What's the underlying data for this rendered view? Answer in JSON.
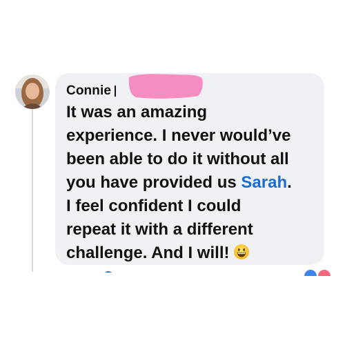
{
  "comment": {
    "author": "Connie",
    "text_lines": [
      "It was an amazing",
      "experience. I never would’ve",
      "been able to do it without all",
      "you have provided us",
      "I feel confident I could",
      "repeat it with a different",
      "challenge. And I will!"
    ],
    "mention": "Sarah",
    "mention_suffix": ".",
    "emoji_name": "grinning-face-icon"
  },
  "colors": {
    "bubble": "#eff1f4",
    "text": "#111111",
    "mention": "#1b6bd3",
    "redaction": "#f58cc2",
    "thread_line": "#d7d9de"
  }
}
